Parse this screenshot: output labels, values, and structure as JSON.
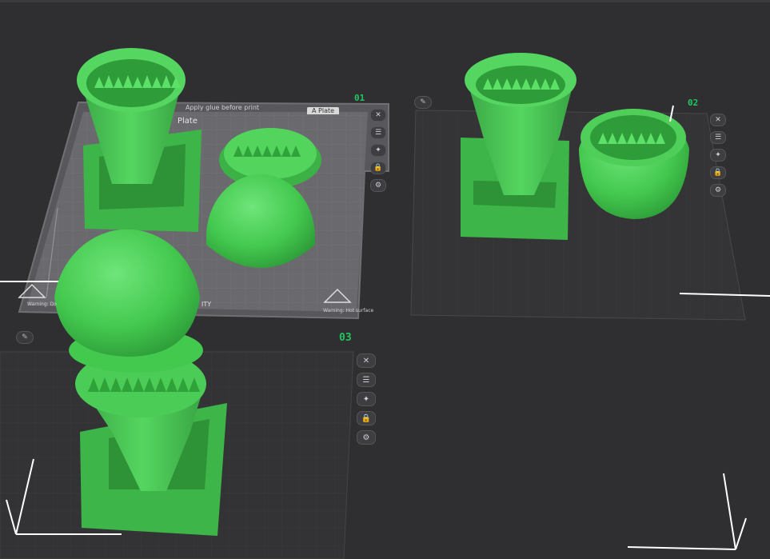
{
  "plates": [
    {
      "label": "01"
    },
    {
      "label": "02"
    },
    {
      "label": "03"
    }
  ],
  "bed1": {
    "notice": "Apply glue before print",
    "plate_tab": "A Plate",
    "plate_title": "Plate",
    "warning_left": "Warning: Do",
    "brand_fragment": "ITY",
    "warning_right": "Warning: Hot surface"
  },
  "plate_tools": {
    "close": "✕",
    "list": "☰",
    "auto": "✦",
    "lock": "🔒",
    "settings": "⚙",
    "edit": "✎"
  },
  "colors": {
    "background": "#2f2f32",
    "model": "#44c94f",
    "plate_label": "#22c55e"
  }
}
